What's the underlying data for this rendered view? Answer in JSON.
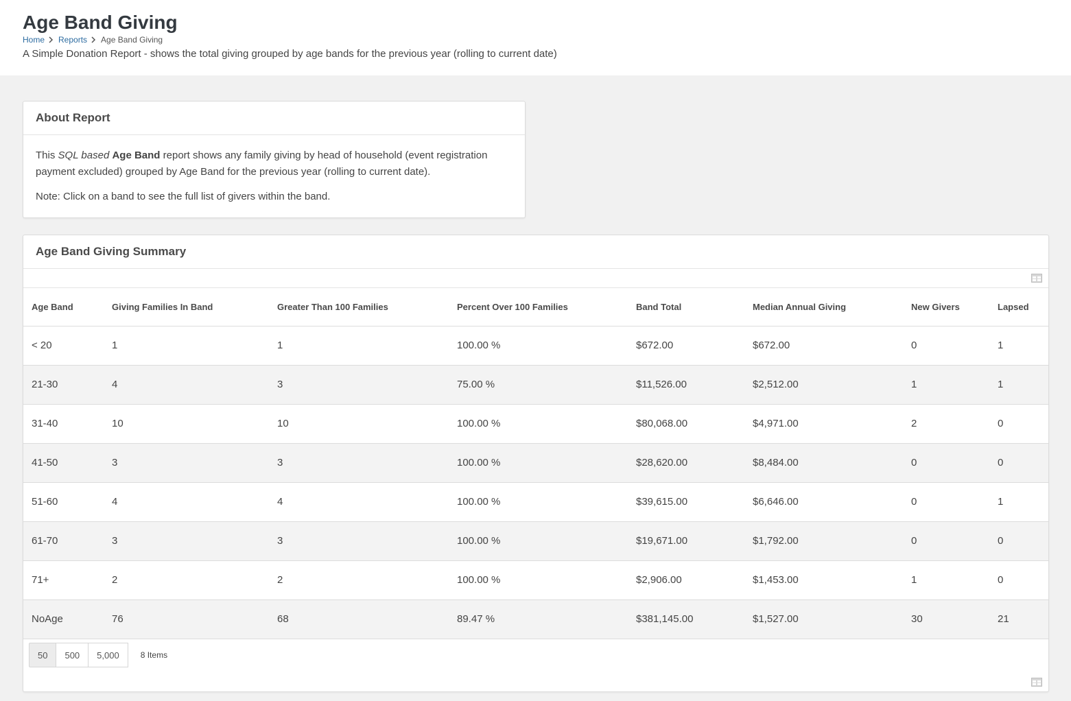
{
  "header": {
    "title": "Age Band Giving",
    "breadcrumbs": [
      "Home",
      "Reports",
      "Age Band Giving"
    ],
    "description": "A Simple Donation Report - shows the total giving grouped by age bands for the previous year (rolling to current date)"
  },
  "about": {
    "title": "About Report",
    "p1_this": "This",
    "p1_sql": "SQL based",
    "p1_ageband": "Age Band",
    "p1_rest": "report shows any family giving by head of household (event registration payment excluded) grouped by Age Band for the previous year (rolling to current date).",
    "p2": "Note: Click on a band to see the full list of givers within the band."
  },
  "summary": {
    "title": "Age Band Giving Summary",
    "columns": [
      "Age Band",
      "Giving Families In Band",
      "Greater Than 100 Families",
      "Percent Over 100 Families",
      "Band Total",
      "Median Annual Giving",
      "New Givers",
      "Lapsed"
    ],
    "rows": [
      [
        "< 20",
        "1",
        "1",
        "100.00 %",
        "$672.00",
        "$672.00",
        "0",
        "1"
      ],
      [
        "21-30",
        "4",
        "3",
        "75.00 %",
        "$11,526.00",
        "$2,512.00",
        "1",
        "1"
      ],
      [
        "31-40",
        "10",
        "10",
        "100.00 %",
        "$80,068.00",
        "$4,971.00",
        "2",
        "0"
      ],
      [
        "41-50",
        "3",
        "3",
        "100.00 %",
        "$28,620.00",
        "$8,484.00",
        "0",
        "0"
      ],
      [
        "51-60",
        "4",
        "4",
        "100.00 %",
        "$39,615.00",
        "$6,646.00",
        "0",
        "1"
      ],
      [
        "61-70",
        "3",
        "3",
        "100.00 %",
        "$19,671.00",
        "$1,792.00",
        "0",
        "0"
      ],
      [
        "71+",
        "2",
        "2",
        "100.00 %",
        "$2,906.00",
        "$1,453.00",
        "1",
        "0"
      ],
      [
        "NoAge",
        "76",
        "68",
        "89.47 %",
        "$381,145.00",
        "$1,527.00",
        "30",
        "21"
      ]
    ],
    "page_sizes": [
      "50",
      "500",
      "5,000"
    ],
    "active_page_size": "50",
    "item_count": "8 Items"
  },
  "colors": {
    "link": "#2c6ba0",
    "background": "#f1f1f1",
    "row_alt": "#f3f3f3"
  }
}
